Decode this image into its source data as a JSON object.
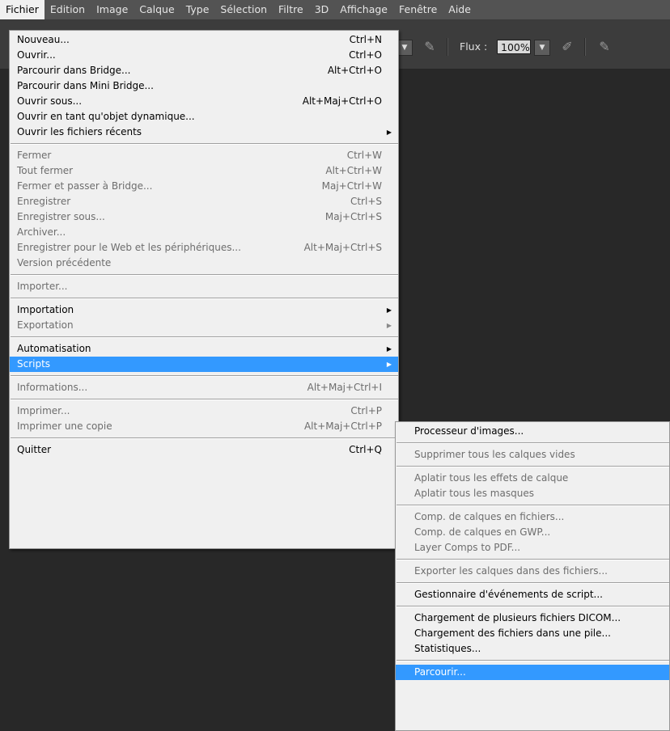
{
  "menubar": {
    "items": [
      "Fichier",
      "Edition",
      "Image",
      "Calque",
      "Type",
      "Sélection",
      "Filtre",
      "3D",
      "Affichage",
      "Fenêtre",
      "Aide"
    ]
  },
  "options_bar": {
    "flux_label": "Flux :",
    "flux_value": "100%"
  },
  "fichier_menu": {
    "items": [
      {
        "label": "Nouveau...",
        "shortcut": "Ctrl+N"
      },
      {
        "label": "Ouvrir...",
        "shortcut": "Ctrl+O"
      },
      {
        "label": "Parcourir dans Bridge...",
        "shortcut": "Alt+Ctrl+O"
      },
      {
        "label": "Parcourir dans Mini Bridge...",
        "shortcut": ""
      },
      {
        "label": "Ouvrir sous...",
        "shortcut": "Alt+Maj+Ctrl+O"
      },
      {
        "label": "Ouvrir en tant qu'objet dynamique...",
        "shortcut": ""
      },
      {
        "label": "Ouvrir les fichiers récents",
        "shortcut": ""
      },
      {
        "label": "Fermer",
        "shortcut": "Ctrl+W"
      },
      {
        "label": "Tout fermer",
        "shortcut": "Alt+Ctrl+W"
      },
      {
        "label": "Fermer et passer à Bridge...",
        "shortcut": "Maj+Ctrl+W"
      },
      {
        "label": "Enregistrer",
        "shortcut": "Ctrl+S"
      },
      {
        "label": "Enregistrer sous...",
        "shortcut": "Maj+Ctrl+S"
      },
      {
        "label": "Archiver...",
        "shortcut": ""
      },
      {
        "label": "Enregistrer pour le Web et les périphériques...",
        "shortcut": "Alt+Maj+Ctrl+S"
      },
      {
        "label": "Version précédente",
        "shortcut": ""
      },
      {
        "label": "Importer...",
        "shortcut": ""
      },
      {
        "label": "Importation",
        "shortcut": ""
      },
      {
        "label": "Exportation",
        "shortcut": ""
      },
      {
        "label": "Automatisation",
        "shortcut": ""
      },
      {
        "label": "Scripts",
        "shortcut": ""
      },
      {
        "label": "Informations...",
        "shortcut": "Alt+Maj+Ctrl+I"
      },
      {
        "label": "Imprimer...",
        "shortcut": "Ctrl+P"
      },
      {
        "label": "Imprimer une copie",
        "shortcut": "Alt+Maj+Ctrl+P"
      },
      {
        "label": "Quitter",
        "shortcut": "Ctrl+Q"
      }
    ]
  },
  "scripts_menu": {
    "items": [
      {
        "label": "Processeur d'images..."
      },
      {
        "label": "Supprimer tous les calques vides"
      },
      {
        "label": "Aplatir tous les effets de calque"
      },
      {
        "label": "Aplatir tous les masques"
      },
      {
        "label": "Comp. de calques en fichiers..."
      },
      {
        "label": "Comp. de calques en GWP..."
      },
      {
        "label": "Layer Comps to PDF..."
      },
      {
        "label": "Exporter les calques dans des fichiers..."
      },
      {
        "label": "Gestionnaire d'événements de script..."
      },
      {
        "label": "Chargement de plusieurs fichiers DICOM..."
      },
      {
        "label": "Chargement des fichiers dans une pile..."
      },
      {
        "label": "Statistiques..."
      },
      {
        "label": "Parcourir..."
      }
    ]
  },
  "colors": {
    "highlight": "#3399ff",
    "menu_bg": "#f0f0f0",
    "canvas_bg": "#282828"
  }
}
